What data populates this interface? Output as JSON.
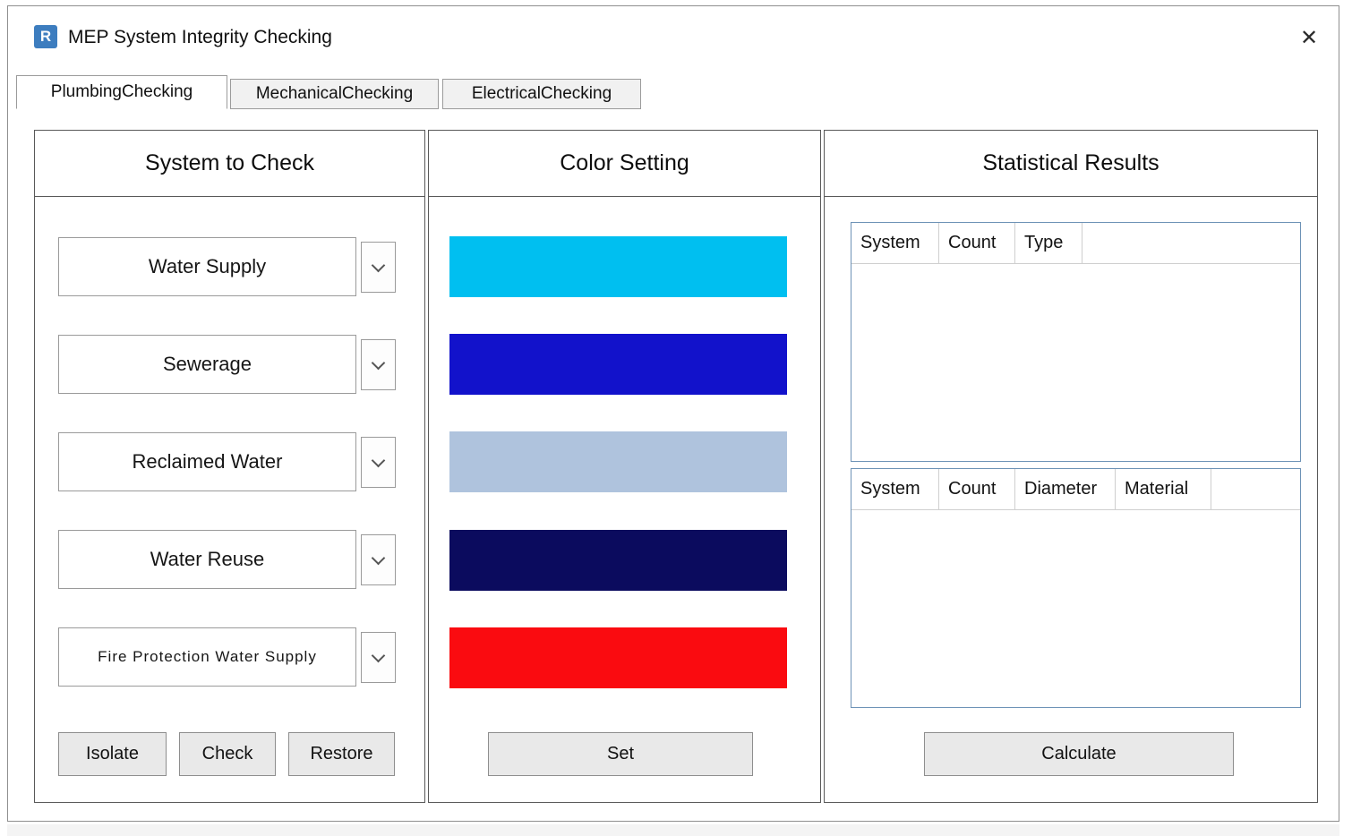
{
  "window": {
    "title": "MEP System Integrity Checking",
    "icon_letter": "R",
    "close_glyph": "✕"
  },
  "tabs": [
    {
      "label": "PlumbingChecking",
      "active": true
    },
    {
      "label": "MechanicalChecking",
      "active": false
    },
    {
      "label": "ElectricalChecking",
      "active": false
    }
  ],
  "system_panel": {
    "title": "System to Check",
    "systems": [
      "Water Supply",
      "Sewerage",
      "Reclaimed Water",
      "Water Reuse",
      "Fire Protection Water Supply"
    ],
    "isolate_label": "Isolate",
    "check_label": "Check",
    "restore_label": "Restore",
    "dropdown_icon": "chevron-down"
  },
  "color_panel": {
    "title": "Color Setting",
    "colors": [
      "#00BFF0",
      "#1212CB",
      "#AFC3DD",
      "#0B0B5E",
      "#FA0B10"
    ],
    "set_label": "Set"
  },
  "results_panel": {
    "title": "Statistical Results",
    "type_table_headers": [
      "System",
      "Count",
      "Type"
    ],
    "type_table_rows": [],
    "pipe_table_headers": [
      "System",
      "Count",
      "Diameter",
      "Material"
    ],
    "pipe_table_rows": [],
    "calculate_label": "Calculate"
  }
}
